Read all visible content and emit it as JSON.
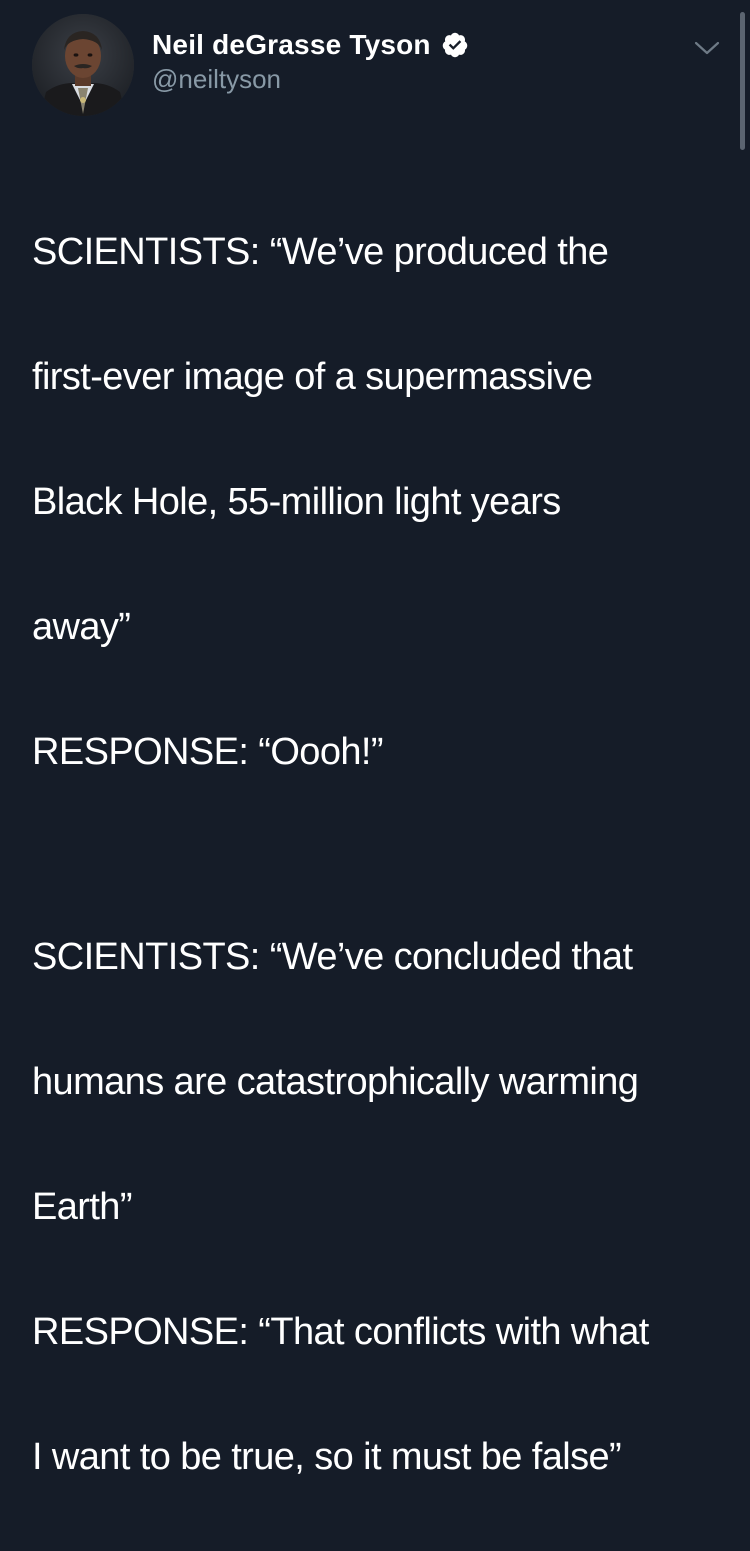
{
  "tweet": {
    "author": {
      "display_name": "Neil deGrasse Tyson",
      "handle": "@neiltyson",
      "verified_icon": "verified-badge-icon",
      "avatar_icon": "profile-photo"
    },
    "menu_icon": "chevron-down-icon",
    "paragraphs": [
      {
        "lines": [
          "SCIENTISTS: “We’ve produced the",
          "first-ever image of a supermassive",
          "Black Hole, 55-million light years",
          "away”",
          "RESPONSE: “Oooh!”"
        ]
      },
      {
        "lines": [
          "SCIENTISTS: “We’ve concluded that",
          "humans are catastrophically warming",
          "Earth”",
          "RESPONSE: “That conflicts with what",
          "I want to be true, so it must be false”"
        ]
      }
    ]
  },
  "colors": {
    "background": "#151c28",
    "text": "#ffffff",
    "secondary_text": "#8899a6",
    "scrollbar": "#5b6470"
  }
}
